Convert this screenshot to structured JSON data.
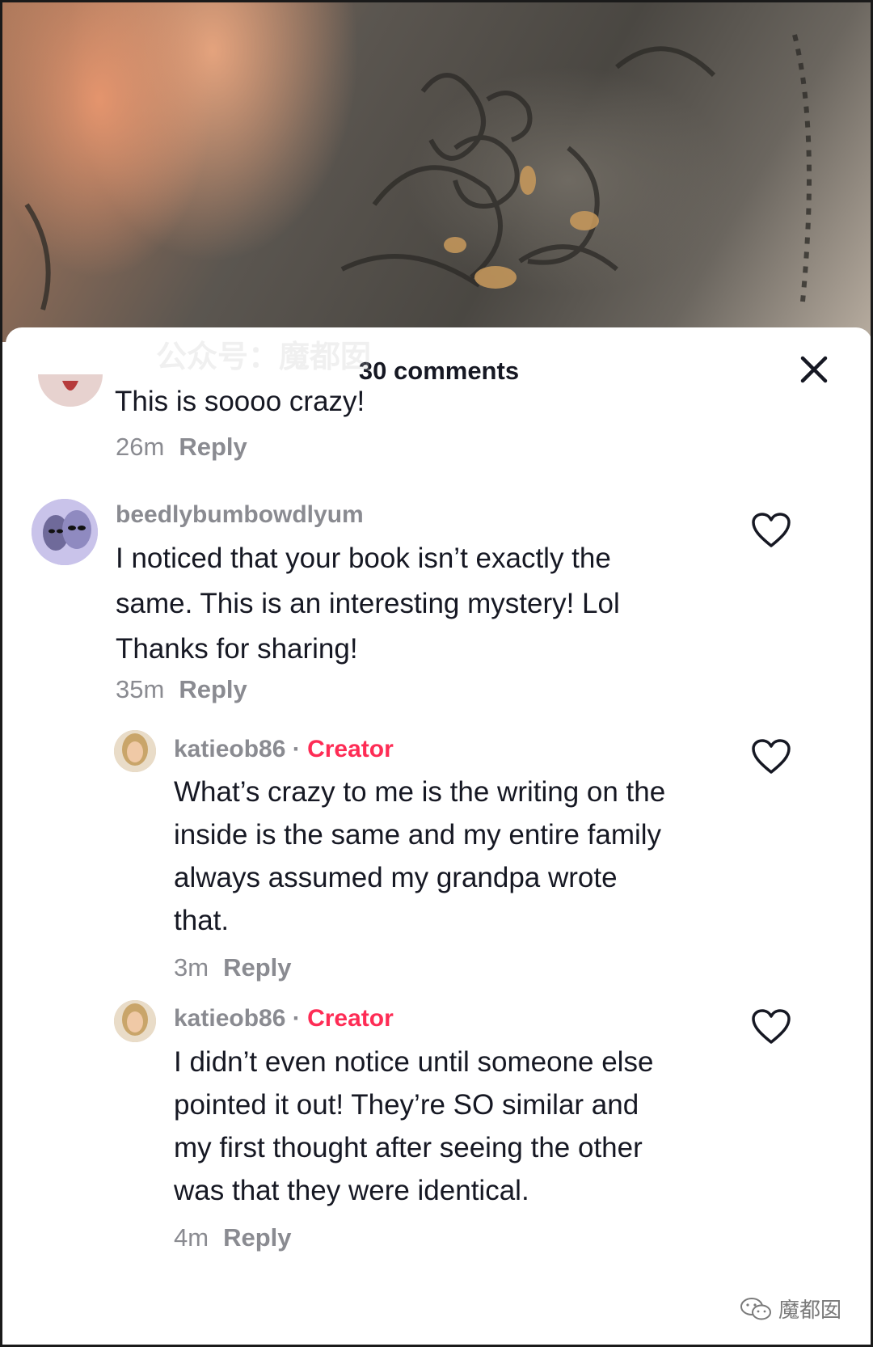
{
  "sheet": {
    "title": "30 comments"
  },
  "comments": [
    {
      "text": "This is soooo crazy!",
      "time": "26m",
      "reply_label": "Reply"
    },
    {
      "username": "beedlybumbowdlyum",
      "text_lines": [
        "I noticed that your book isn’t exactly the",
        "same. This is an interesting mystery! Lol",
        "Thanks for sharing!"
      ],
      "time": "35m",
      "reply_label": "Reply"
    },
    {
      "username": "katieob86",
      "separator": "·",
      "badge": "Creator",
      "text_lines": [
        "What’s crazy to me is the writing on the",
        "inside is the same and my entire family",
        "always assumed my grandpa wrote",
        "that."
      ],
      "time": "3m",
      "reply_label": "Reply"
    },
    {
      "username": "katieob86",
      "separator": "·",
      "badge": "Creator",
      "text_lines": [
        "I didn’t even notice until someone else",
        "pointed it out! They’re SO similar and",
        "my first thought after seeing the other",
        "was that they were identical."
      ],
      "time": "4m",
      "reply_label": "Reply"
    }
  ],
  "watermark": {
    "text": "魔都囡",
    "overlay_text": "公众号：魔都囡"
  },
  "icons": {
    "close": "close-icon",
    "like": "heart-outline-icon",
    "wechat": "wechat-icon"
  },
  "colors": {
    "creator_badge": "#fe2c55",
    "meta_text": "#8a8b91",
    "body_text": "#161823"
  }
}
